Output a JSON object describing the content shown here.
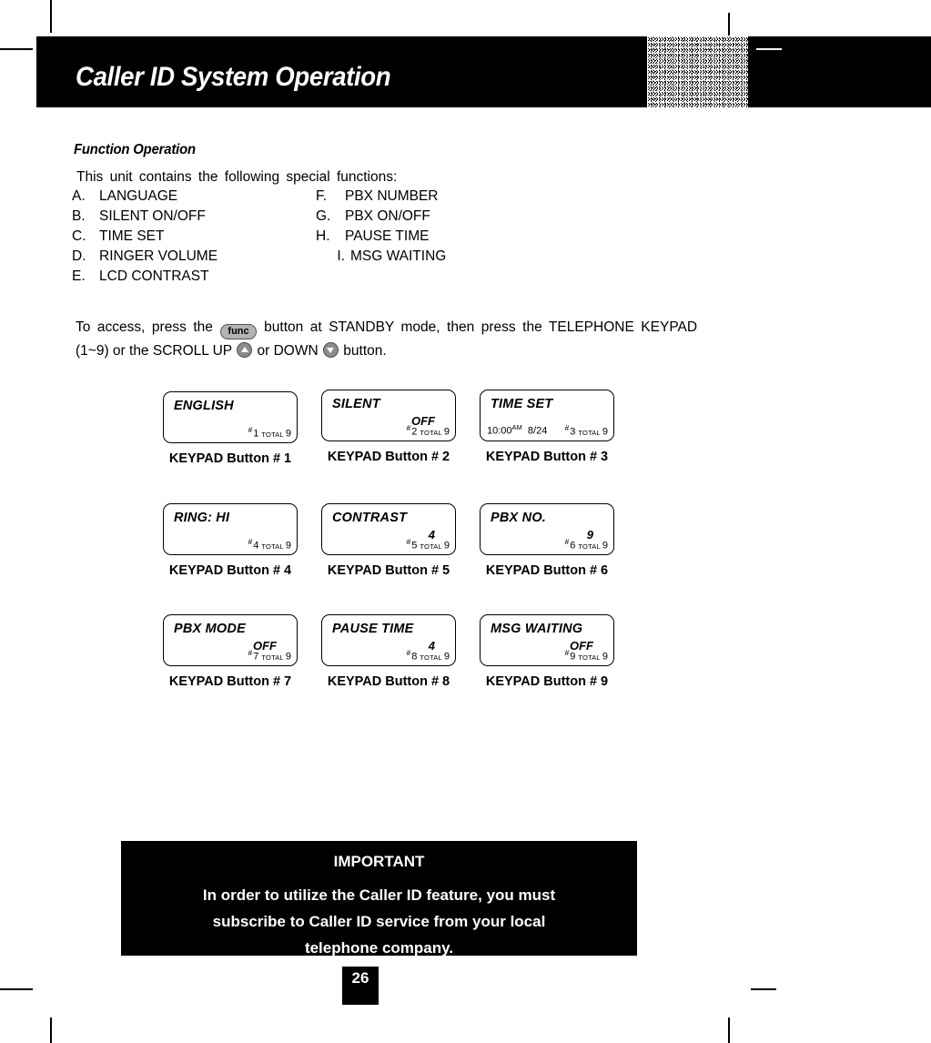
{
  "page": {
    "header_title": "Caller ID System Operation",
    "page_number": "26"
  },
  "section": {
    "title": "Function Operation",
    "intro": "This unit contains the following special functions:"
  },
  "functions": [
    {
      "left_letter": "A.",
      "left_label": "LANGUAGE",
      "right_letter": "F.",
      "right_label": "PBX NUMBER"
    },
    {
      "left_letter": "B.",
      "left_label": "SILENT ON/OFF",
      "right_letter": "G.",
      "right_label": "PBX ON/OFF"
    },
    {
      "left_letter": "C.",
      "left_label": "TIME SET",
      "right_letter": "H.",
      "right_label": "PAUSE TIME"
    },
    {
      "left_letter": "D.",
      "left_label": "RINGER VOLUME",
      "right_letter": "I.",
      "right_label": "MSG WAITING"
    },
    {
      "left_letter": "E.",
      "left_label": "LCD CONTRAST",
      "right_letter": "",
      "right_label": ""
    }
  ],
  "access": {
    "line1_part1": "To access, press the",
    "func_button_label": "func",
    "line1_part2": "button at STANDBY mode, then press the TELEPHONE KEYPAD",
    "line2_part1": "(1~9) or the SCROLL UP",
    "line2_part2": "or DOWN",
    "line2_part3": "button."
  },
  "displays": [
    {
      "title": "ENGLISH",
      "value": "",
      "clock": "",
      "index_label": "1",
      "total_label": "TOTAL",
      "total_value": "9",
      "caption": "KEYPAD Button # 1"
    },
    {
      "title": "SILENT",
      "value": "OFF",
      "clock": "",
      "index_label": "2",
      "total_label": "TOTAL",
      "total_value": "9",
      "caption": "KEYPAD Button # 2"
    },
    {
      "title": "TIME SET",
      "value": "",
      "clock": "10:00",
      "clock_suffix": "AM",
      "date": "8/24",
      "index_label": "3",
      "total_label": "TOTAL",
      "total_value": "9",
      "caption": "KEYPAD Button # 3"
    },
    {
      "title": "RING: HI",
      "value": "",
      "clock": "",
      "index_label": "4",
      "total_label": "TOTAL",
      "total_value": "9",
      "caption": "KEYPAD Button # 4"
    },
    {
      "title": "CONTRAST",
      "value": "4",
      "clock": "",
      "index_label": "5",
      "total_label": "TOTAL",
      "total_value": "9",
      "caption": "KEYPAD Button # 5"
    },
    {
      "title": "PBX NO.",
      "value": "9",
      "clock": "",
      "index_label": "6",
      "total_label": "TOTAL",
      "total_value": "9",
      "caption": "KEYPAD Button # 6"
    },
    {
      "title": "PBX MODE",
      "value": "OFF",
      "clock": "",
      "index_label": "7",
      "total_label": "TOTAL",
      "total_value": "9",
      "caption": "KEYPAD Button # 7"
    },
    {
      "title": "PAUSE TIME",
      "value": "4",
      "clock": "",
      "index_label": "8",
      "total_label": "TOTAL",
      "total_value": "9",
      "caption": "KEYPAD Button # 8"
    },
    {
      "title": "MSG WAITING",
      "value": "OFF",
      "clock": "",
      "index_label": "9",
      "total_label": "TOTAL",
      "total_value": "9",
      "caption": "KEYPAD Button # 9"
    }
  ],
  "important": {
    "heading": "IMPORTANT",
    "line1": "In order to utilize the Caller ID feature, you must",
    "line2": "subscribe to Caller ID service from your local",
    "line3": "telephone company."
  },
  "colors": {
    "ink": "#000000",
    "paper": "#ffffff",
    "button_gray": "#b3b3b3"
  }
}
